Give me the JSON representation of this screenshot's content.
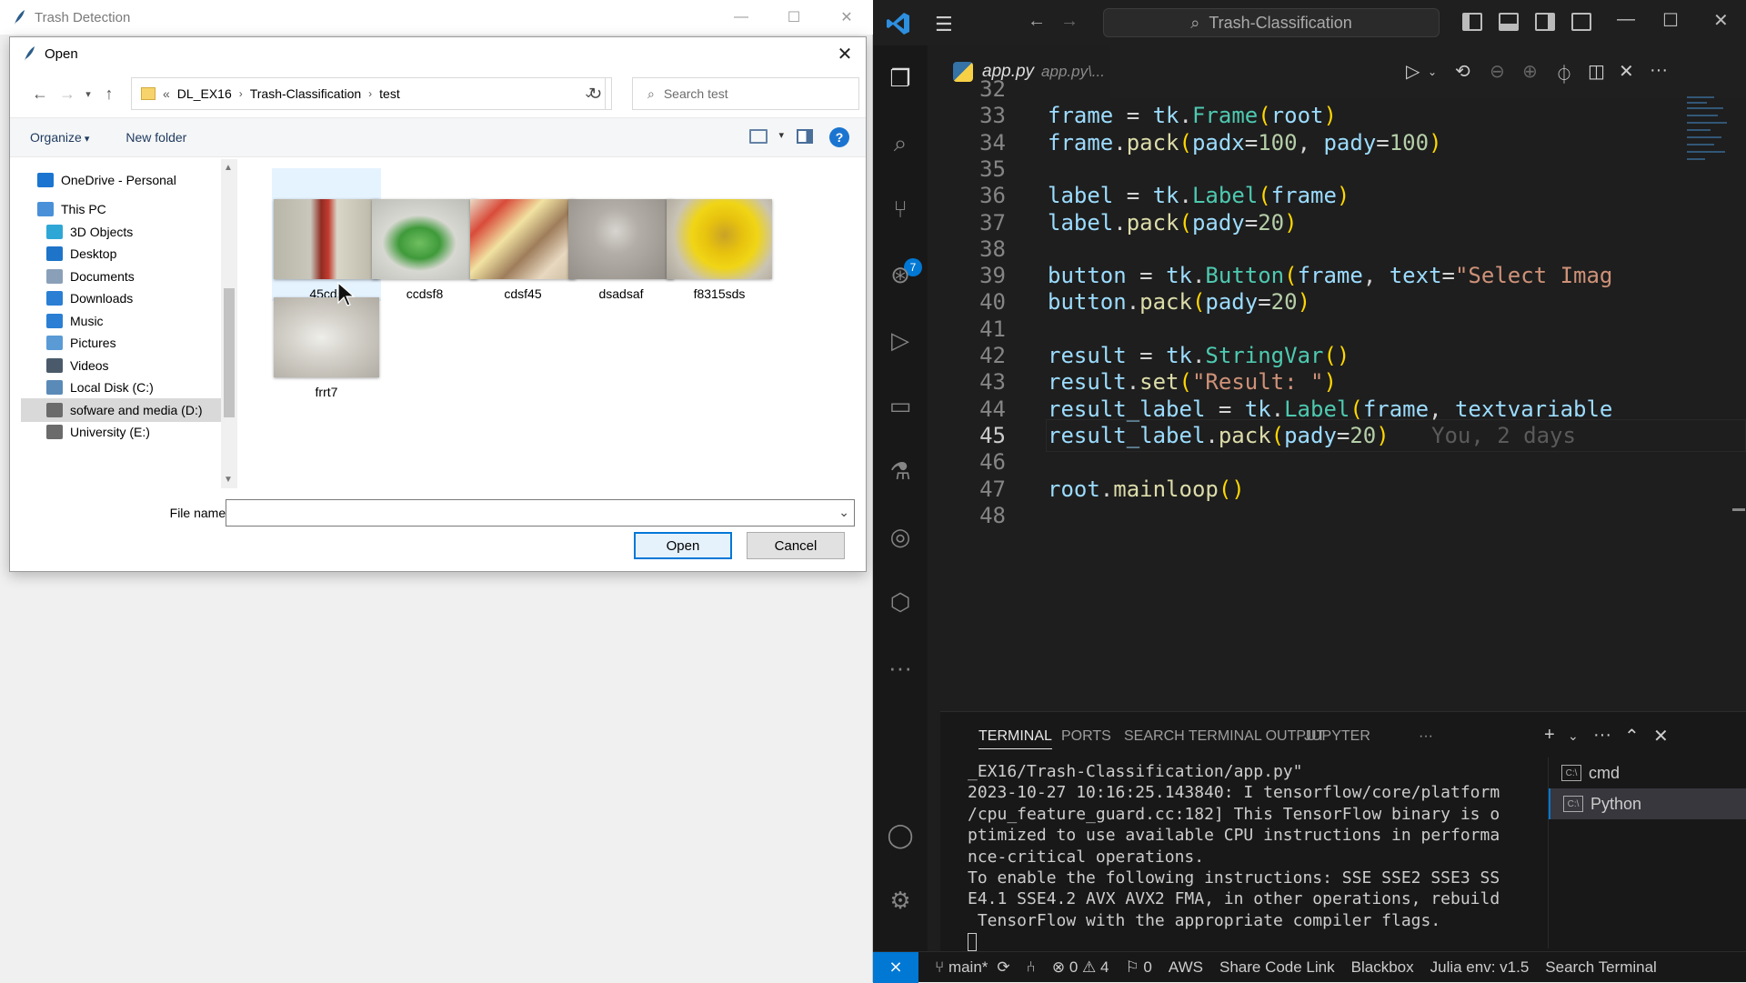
{
  "tk": {
    "title": "Trash Detection",
    "controls": [
      "—",
      "☐",
      "✕"
    ]
  },
  "dialog": {
    "title": "Open",
    "breadcrumb": [
      "«",
      "DL_EX16",
      "Trash-Classification",
      "test"
    ],
    "search_placeholder": "Search test",
    "toolbar": {
      "organize": "Organize",
      "new_folder": "New folder",
      "help": "?"
    },
    "nav": [
      {
        "label": "OneDrive - Personal",
        "color": "#1b75d0"
      },
      {
        "label": "This PC",
        "color": "#4a90d9"
      },
      {
        "label": "3D Objects",
        "color": "#2fa7d6"
      },
      {
        "label": "Desktop",
        "color": "#1e74c9"
      },
      {
        "label": "Documents",
        "color": "#8aa0b8"
      },
      {
        "label": "Downloads",
        "color": "#2a7fd4"
      },
      {
        "label": "Music",
        "color": "#2a7fd4"
      },
      {
        "label": "Pictures",
        "color": "#5a9bd5"
      },
      {
        "label": "Videos",
        "color": "#4a5a6a"
      },
      {
        "label": "Local Disk (C:)",
        "color": "#5a8ab8"
      },
      {
        "label": "sofware and media (D:)",
        "color": "#6b6b6b"
      },
      {
        "label": "University (E:)",
        "color": "#6b6b6b"
      }
    ],
    "files": [
      {
        "name": "45cds",
        "thumb": "bottle"
      },
      {
        "name": "ccdsf8",
        "thumb": "bag"
      },
      {
        "name": "cdsf45",
        "thumb": "paper"
      },
      {
        "name": "dsadsaf",
        "thumb": "glass"
      },
      {
        "name": "f8315sds",
        "thumb": "lid"
      },
      {
        "name": "frrt7",
        "thumb": "plastic"
      }
    ],
    "filename_label": "File name:",
    "filename_value": "",
    "open_label": "Open",
    "cancel_label": "Cancel"
  },
  "vscode": {
    "search": "Trash-Classification",
    "tab_name": "app.py",
    "tab_path": "app.py\\...",
    "scm_badge": "7",
    "code": [
      {
        "n": "32",
        "t": ""
      },
      {
        "n": "33",
        "t": "frame = tk.Frame(root)"
      },
      {
        "n": "34",
        "t": "frame.pack(padx=100, pady=100)"
      },
      {
        "n": "35",
        "t": ""
      },
      {
        "n": "36",
        "t": "label = tk.Label(frame)"
      },
      {
        "n": "37",
        "t": "label.pack(pady=20)"
      },
      {
        "n": "38",
        "t": ""
      },
      {
        "n": "39",
        "t": "button = tk.Button(frame, text=\"Select Imag"
      },
      {
        "n": "40",
        "t": "button.pack(pady=20)"
      },
      {
        "n": "41",
        "t": ""
      },
      {
        "n": "42",
        "t": "result = tk.StringVar()"
      },
      {
        "n": "43",
        "t": "result.set(\"Result: \")"
      },
      {
        "n": "44",
        "t": "result_label = tk.Label(frame, textvariable"
      },
      {
        "n": "45",
        "t": "result_label.pack(pady=20)"
      },
      {
        "n": "46",
        "t": ""
      },
      {
        "n": "47",
        "t": "root.mainloop()"
      },
      {
        "n": "48",
        "t": ""
      }
    ],
    "blame": "You, 2 days",
    "panel_tabs": [
      "TERMINAL",
      "PORTS",
      "SEARCH TERMINAL OUTPUT",
      "JUPYTER"
    ],
    "panel_more": "···",
    "terminal_lines": [
      "_EX16/Trash-Classification/app.py\"",
      "2023-10-27 10:16:25.143840: I tensorflow/core/platform",
      "/cpu_feature_guard.cc:182] This TensorFlow binary is o",
      "ptimized to use available CPU instructions in performa",
      "nce-critical operations.",
      "To enable the following instructions: SSE SSE2 SSE3 SS",
      "E4.1 SSE4.2 AVX AVX2 FMA, in other operations, rebuild",
      " TensorFlow with the appropriate compiler flags."
    ],
    "terminals": [
      "cmd",
      "Python"
    ],
    "status": {
      "branch": "main*",
      "errors": "0",
      "warnings": "4",
      "ports": "0",
      "aws": "AWS",
      "share": "Share Code Link",
      "blackbox": "Blackbox",
      "julia": "Julia env: v1.5",
      "search_terminal": "Search Terminal"
    }
  }
}
